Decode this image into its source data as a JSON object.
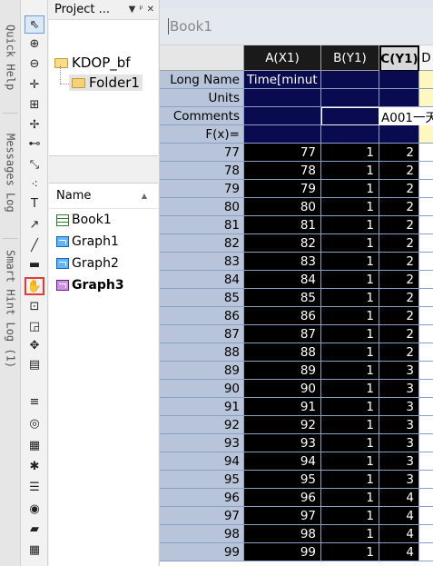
{
  "side_tabs": [
    "Quick Help",
    "Messages Log",
    "Smart Hint Log (1)"
  ],
  "project": {
    "title": "Project ...",
    "controls": [
      "▼",
      "ᵖ",
      "✕"
    ],
    "tree": {
      "root": "KDOP_bf",
      "child": "Folder1"
    },
    "list": {
      "column": "Name",
      "items": [
        {
          "name": "Book1",
          "type": "workbook"
        },
        {
          "name": "Graph1",
          "type": "graph"
        },
        {
          "name": "Graph2",
          "type": "graph"
        },
        {
          "name": "Graph3",
          "type": "graph",
          "active": true
        }
      ]
    }
  },
  "book": {
    "title": "Book1",
    "columns": [
      "A(X1)",
      "B(Y1)",
      "C(Y1)",
      "D"
    ],
    "label_rows": [
      {
        "name": "Long Name",
        "a": "Time[minut",
        "b": "",
        "c": ""
      },
      {
        "name": "Units",
        "a": "",
        "b": "",
        "c": ""
      },
      {
        "name": "Comments",
        "a": "",
        "b": "",
        "c": "A001一天"
      },
      {
        "name": "F(x)=",
        "a": "",
        "b": "",
        "c": ""
      }
    ],
    "rows": [
      {
        "n": "77",
        "a": "77",
        "b": "1",
        "c": "2"
      },
      {
        "n": "78",
        "a": "78",
        "b": "1",
        "c": "2"
      },
      {
        "n": "79",
        "a": "79",
        "b": "1",
        "c": "2"
      },
      {
        "n": "80",
        "a": "80",
        "b": "1",
        "c": "2"
      },
      {
        "n": "81",
        "a": "81",
        "b": "1",
        "c": "2"
      },
      {
        "n": "82",
        "a": "82",
        "b": "1",
        "c": "2"
      },
      {
        "n": "83",
        "a": "83",
        "b": "1",
        "c": "2"
      },
      {
        "n": "84",
        "a": "84",
        "b": "1",
        "c": "2"
      },
      {
        "n": "85",
        "a": "85",
        "b": "1",
        "c": "2"
      },
      {
        "n": "86",
        "a": "86",
        "b": "1",
        "c": "2"
      },
      {
        "n": "87",
        "a": "87",
        "b": "1",
        "c": "2"
      },
      {
        "n": "88",
        "a": "88",
        "b": "1",
        "c": "2"
      },
      {
        "n": "89",
        "a": "89",
        "b": "1",
        "c": "3"
      },
      {
        "n": "90",
        "a": "90",
        "b": "1",
        "c": "3"
      },
      {
        "n": "91",
        "a": "91",
        "b": "1",
        "c": "3"
      },
      {
        "n": "92",
        "a": "92",
        "b": "1",
        "c": "3"
      },
      {
        "n": "93",
        "a": "93",
        "b": "1",
        "c": "3"
      },
      {
        "n": "94",
        "a": "94",
        "b": "1",
        "c": "3"
      },
      {
        "n": "95",
        "a": "95",
        "b": "1",
        "c": "3"
      },
      {
        "n": "96",
        "a": "96",
        "b": "1",
        "c": "4"
      },
      {
        "n": "97",
        "a": "97",
        "b": "1",
        "c": "4"
      },
      {
        "n": "98",
        "a": "98",
        "b": "1",
        "c": "4"
      },
      {
        "n": "99",
        "a": "99",
        "b": "1",
        "c": "4"
      }
    ]
  },
  "tools": [
    {
      "name": "pointer-tool-icon",
      "glyph": "⇖",
      "active": true
    },
    {
      "name": "zoom-in-tool-icon",
      "glyph": "⊕"
    },
    {
      "name": "zoom-out-tool-icon",
      "glyph": "⊖"
    },
    {
      "name": "crosshair-tool-icon",
      "glyph": "✛"
    },
    {
      "name": "screen-reader-tool-icon",
      "glyph": "⊞"
    },
    {
      "name": "data-reader-tool-icon",
      "glyph": "✢"
    },
    {
      "name": "data-cursor-tool-icon",
      "glyph": "⊷"
    },
    {
      "name": "mask-points-tool-icon",
      "glyph": "⤡"
    },
    {
      "name": "scatter-tool-icon",
      "glyph": "⁖"
    },
    {
      "name": "text-tool-icon",
      "glyph": "T"
    },
    {
      "name": "arrow-tool-icon",
      "glyph": "↗"
    },
    {
      "name": "line-tool-icon",
      "glyph": "╱"
    },
    {
      "name": "rectangle-tool-icon",
      "glyph": "▬"
    },
    {
      "name": "hand-tool-icon",
      "glyph": "✋",
      "highlighted": true
    },
    {
      "name": "region-select-tool-icon",
      "glyph": "⊡"
    },
    {
      "name": "graph-mark-tool-icon",
      "glyph": "◲"
    },
    {
      "name": "move-tool-icon",
      "glyph": "✥"
    },
    {
      "name": "layer-tool-icon",
      "glyph": "▤"
    },
    {
      "name": "gripper-icon",
      "glyph": "≡"
    },
    {
      "name": "circle-tool-icon",
      "glyph": "◎"
    },
    {
      "name": "table-insert-tool-icon",
      "glyph": "▦"
    },
    {
      "name": "asterisk-tool-icon",
      "glyph": "✱"
    },
    {
      "name": "list-tool-icon",
      "glyph": "☰"
    },
    {
      "name": "object-tool-icon",
      "glyph": "◉"
    },
    {
      "name": "folder-tool-icon",
      "glyph": "▰"
    },
    {
      "name": "grid-tool-icon",
      "glyph": "▦"
    }
  ]
}
